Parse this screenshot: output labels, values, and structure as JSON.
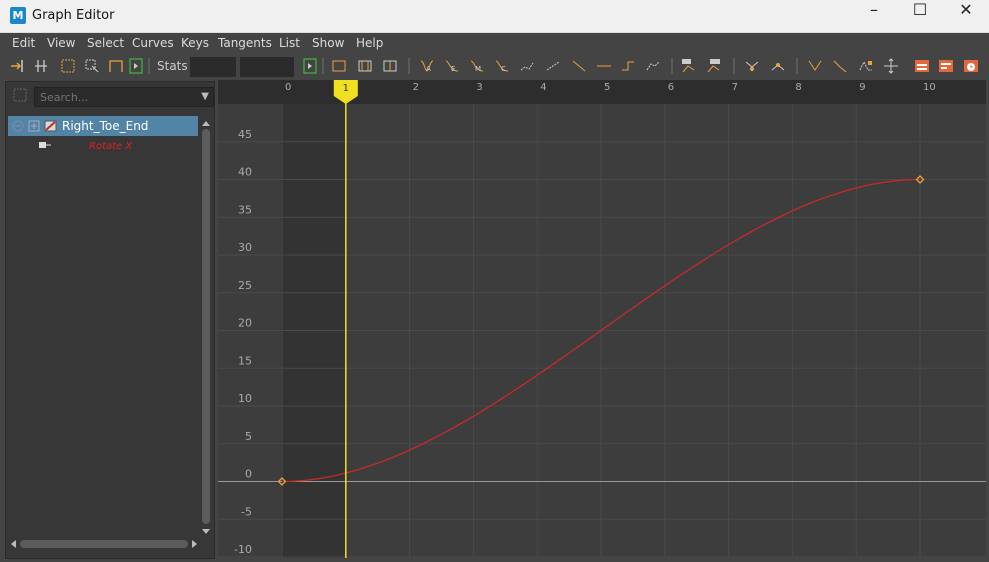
{
  "window": {
    "title": "Graph Editor",
    "app_icon_letter": "M",
    "minimize": "–",
    "maximize": "☐",
    "close": "✕"
  },
  "menu": [
    "Edit",
    "View",
    "Select",
    "Curves",
    "Keys",
    "Tangents",
    "List",
    "Show",
    "Help"
  ],
  "toolbar": {
    "stats_label": "Stats",
    "stats_value_1": "",
    "stats_value_2": ""
  },
  "outliner": {
    "search_placeholder": "Search...",
    "object_name": "Right_Toe_End",
    "attribute_name": "Rotate X"
  },
  "graph": {
    "x_ticks": [
      "0",
      "1",
      "2",
      "3",
      "4",
      "5",
      "6",
      "7",
      "8",
      "9",
      "10"
    ],
    "y_ticks": [
      "45",
      "40",
      "35",
      "30",
      "25",
      "20",
      "15",
      "10",
      "5",
      "0",
      "-5",
      "-10"
    ],
    "current_frame": "1",
    "curve_color": "#c52a2a",
    "key_color": "#e8a23a",
    "time_marker_color": "#f0e020",
    "keys": [
      {
        "frame": 0,
        "value": 0
      },
      {
        "frame": 10,
        "value": 40
      }
    ]
  }
}
